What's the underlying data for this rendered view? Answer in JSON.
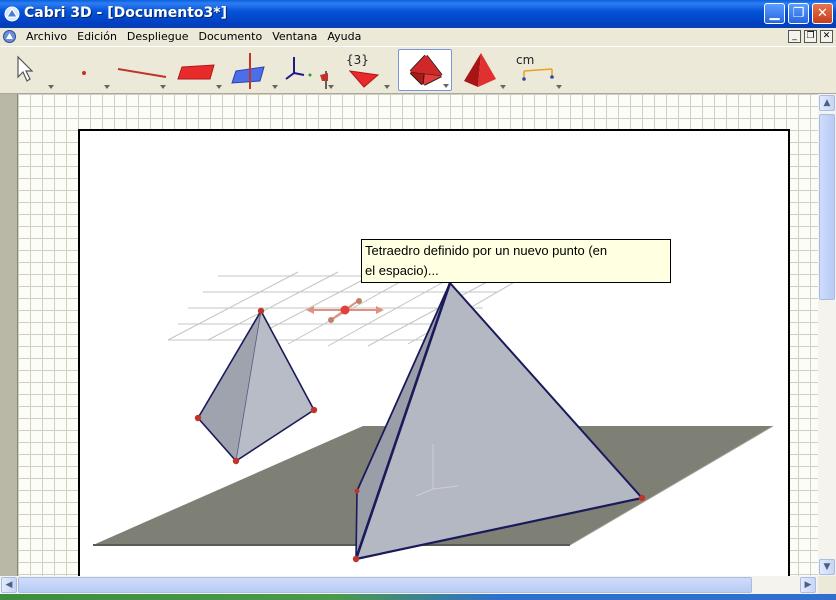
{
  "window": {
    "title": "Cabri 3D - [Documento3*]"
  },
  "menu": {
    "items": [
      "Archivo",
      "Edición",
      "Despliegue",
      "Documento",
      "Ventana",
      "Ayuda"
    ]
  },
  "toolbar": {
    "tools": [
      {
        "id": "pointer",
        "icon": "arrow-pointer-icon"
      },
      {
        "id": "points",
        "icon": "point-icon"
      },
      {
        "id": "lines",
        "icon": "line-icon"
      },
      {
        "id": "surfaces",
        "icon": "plane-icon"
      },
      {
        "id": "relative-construction",
        "icon": "perpendicular-icon"
      },
      {
        "id": "transformations",
        "icon": "transformation-icon"
      },
      {
        "id": "calculator",
        "icon": "triangle-flag-icon",
        "label": "{3}"
      },
      {
        "id": "polyhedra",
        "icon": "tetrahedron-icon",
        "active": true
      },
      {
        "id": "regular-polyhedra",
        "icon": "pyramid-icon"
      },
      {
        "id": "measurement",
        "icon": "measure-icon",
        "label": "cm"
      }
    ]
  },
  "tooltip": {
    "line1": "Tetraedro definido por un nuevo punto (en",
    "line2": "el espacio)..."
  },
  "colors": {
    "titlebar": "#0453d8",
    "plane": "#7e8076",
    "solid": "#a8acb6",
    "edge": "#1a1a5a",
    "point": "#c0342a"
  }
}
